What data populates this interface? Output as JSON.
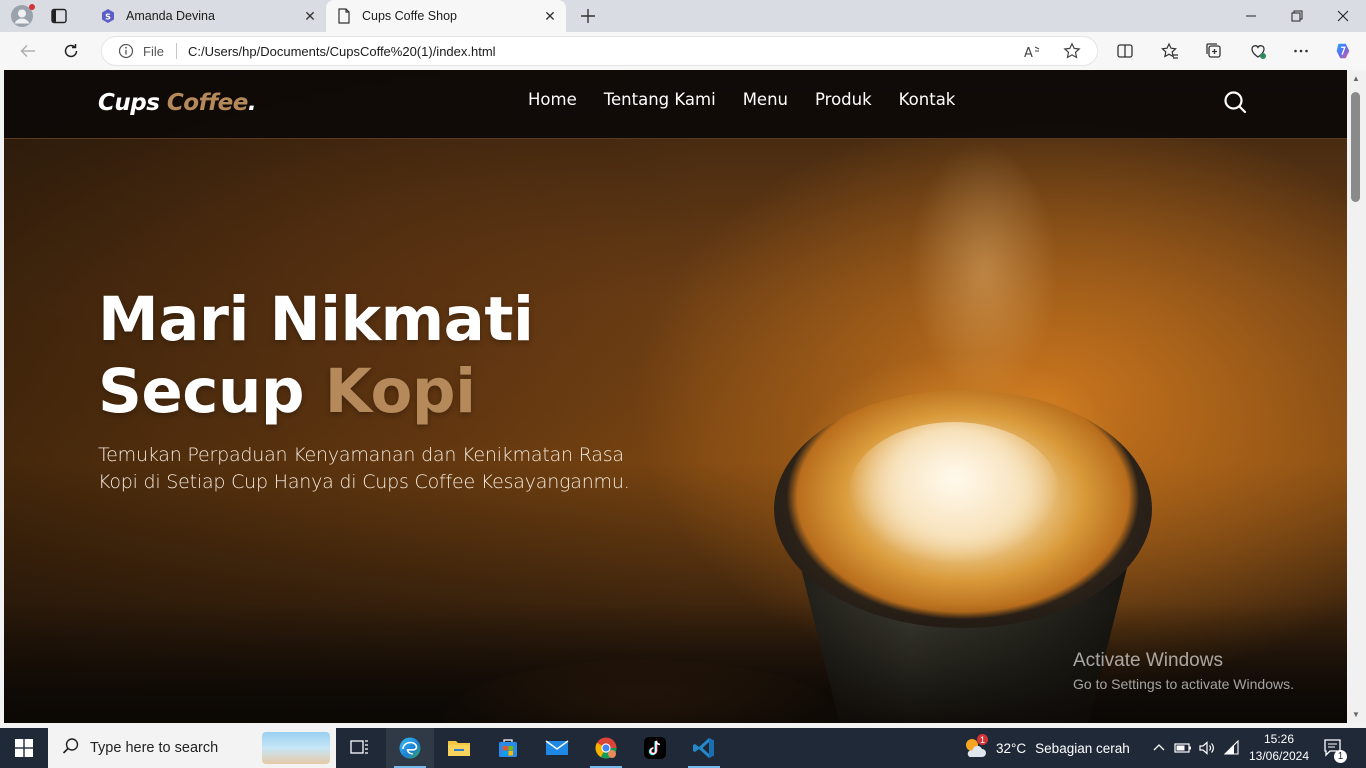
{
  "browser": {
    "tabs": [
      {
        "title": "Amanda Devina",
        "active": false,
        "icon": "s-logo-icon"
      },
      {
        "title": "Cups Coffe Shop",
        "active": true,
        "icon": "page-icon"
      }
    ],
    "address": {
      "scheme_label": "File",
      "url": "C:/Users/hp/Documents/CupsCoffe%20(1)/index.html"
    }
  },
  "site": {
    "logo": {
      "main": "Cups ",
      "accent": "Coffee",
      "dot": "."
    },
    "nav": [
      "Home",
      "Tentang Kami",
      "Menu",
      "Produk",
      "Kontak"
    ],
    "hero": {
      "title_line1": "Mari Nikmati",
      "title_line2_main": "Secup ",
      "title_line2_accent": "Kopi",
      "subtitle": "Temukan Perpaduan Kenyamanan dan Kenikmatan Rasa Kopi di Setiap Cup Hanya di Cups Coffee Kesayanganmu."
    },
    "colors": {
      "accent": "#b6895b",
      "navbar": "#0e0a07"
    }
  },
  "watermark": {
    "line1": "Activate Windows",
    "line2": "Go to Settings to activate Windows."
  },
  "taskbar": {
    "search_placeholder": "Type here to search",
    "weather": {
      "temp": "32°C",
      "desc": "Sebagian cerah",
      "badge": "1"
    },
    "time": "15:26",
    "date": "13/06/2024",
    "notification_count": "1",
    "apps": [
      "task-view-icon",
      "edge-icon",
      "file-explorer-icon",
      "store-icon",
      "mail-icon",
      "chrome-icon",
      "tiktok-icon",
      "vscode-icon"
    ]
  }
}
